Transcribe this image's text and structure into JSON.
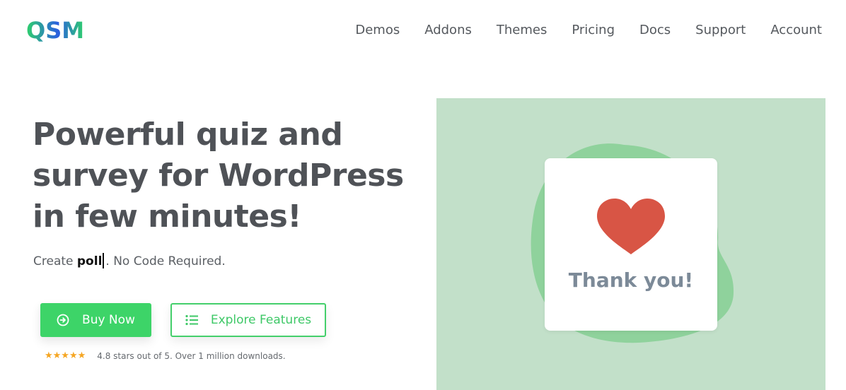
{
  "header": {
    "logo_text": "QSM",
    "nav": [
      "Demos",
      "Addons",
      "Themes",
      "Pricing",
      "Docs",
      "Support",
      "Account"
    ]
  },
  "hero": {
    "headline_lines": [
      "Powerful quiz and",
      "survey for WordPress",
      "in few minutes!"
    ],
    "sub_prefix": "Create ",
    "sub_keyword": "poll",
    "sub_suffix": ". No Code Required.",
    "buy_label": "Buy Now",
    "explore_label": "Explore Features",
    "stars": "★★★★★",
    "rating_text": "4.8 stars out of 5. Over 1 million downloads."
  },
  "illustration": {
    "card_text": "Thank you!"
  },
  "colors": {
    "brand_green": "#3dd468",
    "panel_bg": "#c2e0c9",
    "blob": "#8fd29c",
    "heart": "#d85545",
    "star": "#f5a623"
  },
  "icons": {
    "buy": "arrow-circle-right-icon",
    "explore": "list-icon",
    "card": "heart-icon"
  }
}
